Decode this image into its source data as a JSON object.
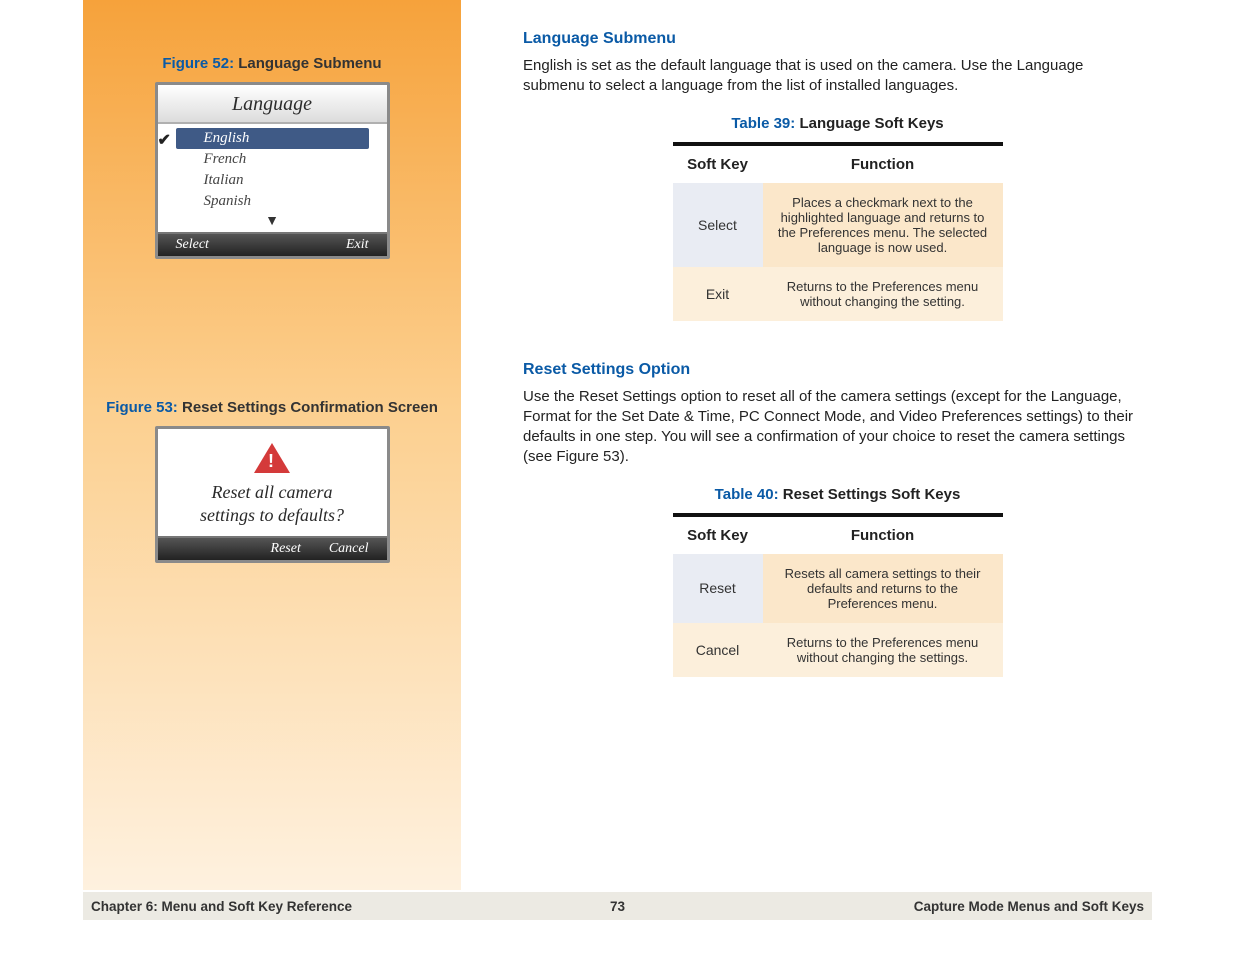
{
  "sidebar": {
    "figure52": {
      "label_prefix": "Figure 52:",
      "label_text": " Language Submenu",
      "lcd_title": "Language",
      "languages": [
        "English",
        "French",
        "Italian",
        "Spanish"
      ],
      "soft_left": "Select",
      "soft_right": "Exit",
      "more_indicator": "▼"
    },
    "figure53": {
      "label_prefix": "Figure 53:",
      "label_text": " Reset Settings Confirmation Screen",
      "body_line1": "Reset all camera",
      "body_line2": "settings to defaults?",
      "soft_left": "Reset",
      "soft_right": "Cancel"
    }
  },
  "main": {
    "section1": {
      "heading": "Language Submenu",
      "para": "English is set as the default language that is used on the camera. Use the Language submenu to select a language from the list of installed languages.",
      "table_caption_prefix": "Table 39:",
      "table_caption_text": " Language Soft Keys",
      "col1": "Soft Key",
      "col2": "Function",
      "rows": [
        {
          "k": "Select",
          "v": "Places a checkmark next to the highlighted language and returns to the Preferences menu. The selected language is now used."
        },
        {
          "k": "Exit",
          "v": "Returns to the Preferences menu without changing the setting."
        }
      ]
    },
    "section2": {
      "heading": "Reset Settings Option",
      "para": "Use the Reset Settings option to reset all of the camera settings (except for the Language, Format for the Set Date & Time, PC Connect Mode, and Video Preferences settings) to their defaults in one step. You will see a confirmation of your choice to reset the camera settings (see Figure 53).",
      "table_caption_prefix": "Table 40:",
      "table_caption_text": " Reset Settings Soft Keys",
      "col1": "Soft Key",
      "col2": "Function",
      "rows": [
        {
          "k": "Reset",
          "v": "Resets all camera settings to their defaults and returns to the Preferences menu."
        },
        {
          "k": "Cancel",
          "v": "Returns to the Preferences menu without changing the settings."
        }
      ]
    }
  },
  "footer": {
    "left": "Chapter 6: Menu and Soft Key Reference",
    "center": "73",
    "right": "Capture Mode Menus and Soft Keys"
  }
}
